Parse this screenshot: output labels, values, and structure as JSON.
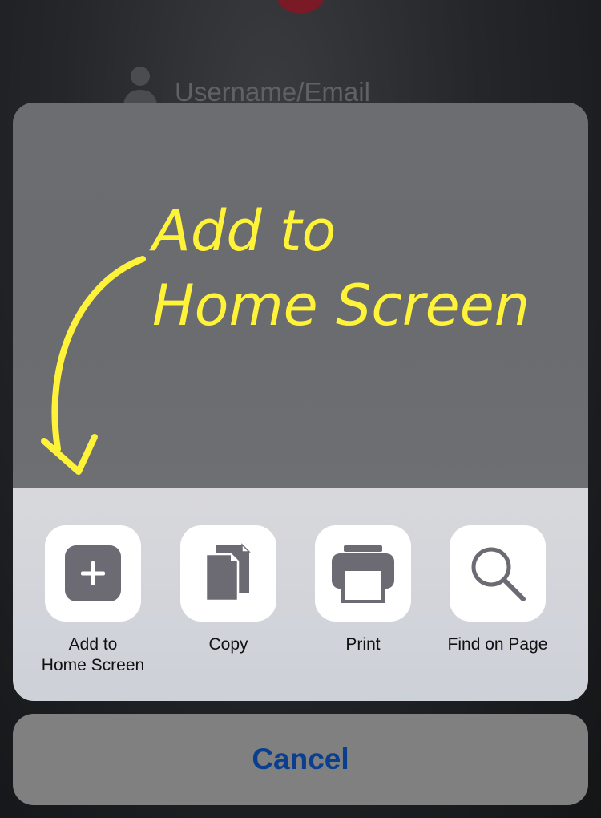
{
  "background": {
    "username_placeholder": "Username/Email"
  },
  "annotation": {
    "line1": "Add to",
    "line2": "Home Screen",
    "color": "#fff33a"
  },
  "actions": [
    {
      "label": "Add to\nHome Screen",
      "icon": "add-square-icon"
    },
    {
      "label": "Copy",
      "icon": "copy-documents-icon"
    },
    {
      "label": "Print",
      "icon": "printer-icon"
    },
    {
      "label": "Find on Page",
      "icon": "magnifier-icon"
    }
  ],
  "cancel": {
    "label": "Cancel",
    "color": "#0a3f8f"
  }
}
